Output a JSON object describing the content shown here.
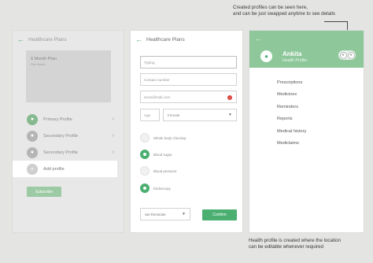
{
  "annotations": {
    "top_line1": "Created profiles can be seen here,",
    "top_line2": "and can be just swapped anytime to see details",
    "bottom_line1": "Health profile is created where the location",
    "bottom_line2": "can be editable whenever required"
  },
  "screen1": {
    "title": "Healthcare Plans",
    "plan_name": "6 Month Plan",
    "plan_sub": "Plan details",
    "profiles": [
      {
        "label": "Primary Profile"
      },
      {
        "label": "Secondary Profile"
      },
      {
        "label": "Secondary Profile"
      }
    ],
    "add_profile": "Add profile",
    "subscribe": "Subscribe"
  },
  "screen2": {
    "title": "Healthcare Plans",
    "name_value": "Typing",
    "contact_placeholder": "Contact number",
    "email_value": "anon@mail.com",
    "error_icon": "!",
    "age_placeholder": "Age",
    "gender_value": "Female",
    "checkups": [
      {
        "label": "Whole body Checkup",
        "checked": false
      },
      {
        "label": "Blood sugar",
        "checked": true
      },
      {
        "label": "Blood pressure",
        "checked": false
      },
      {
        "label": "Endoscopy",
        "checked": true
      }
    ],
    "reminder": "Set Reminder",
    "confirm": "Confirm"
  },
  "screen3": {
    "name": "Ankita",
    "subtitle": "Health Profile",
    "menu": [
      "Prescriptions",
      "Medicines",
      "Reminders",
      "Reports",
      "Medical history",
      "Mediclaims"
    ]
  },
  "colors": {
    "accent": "#4caf72",
    "header_green": "#8dc79a",
    "error": "#d9423a",
    "background": "#e4e5e2"
  },
  "icons": {
    "back": "left-arrow",
    "avatar": "person-icon",
    "chevron": "chevron-right",
    "add": "plus"
  }
}
